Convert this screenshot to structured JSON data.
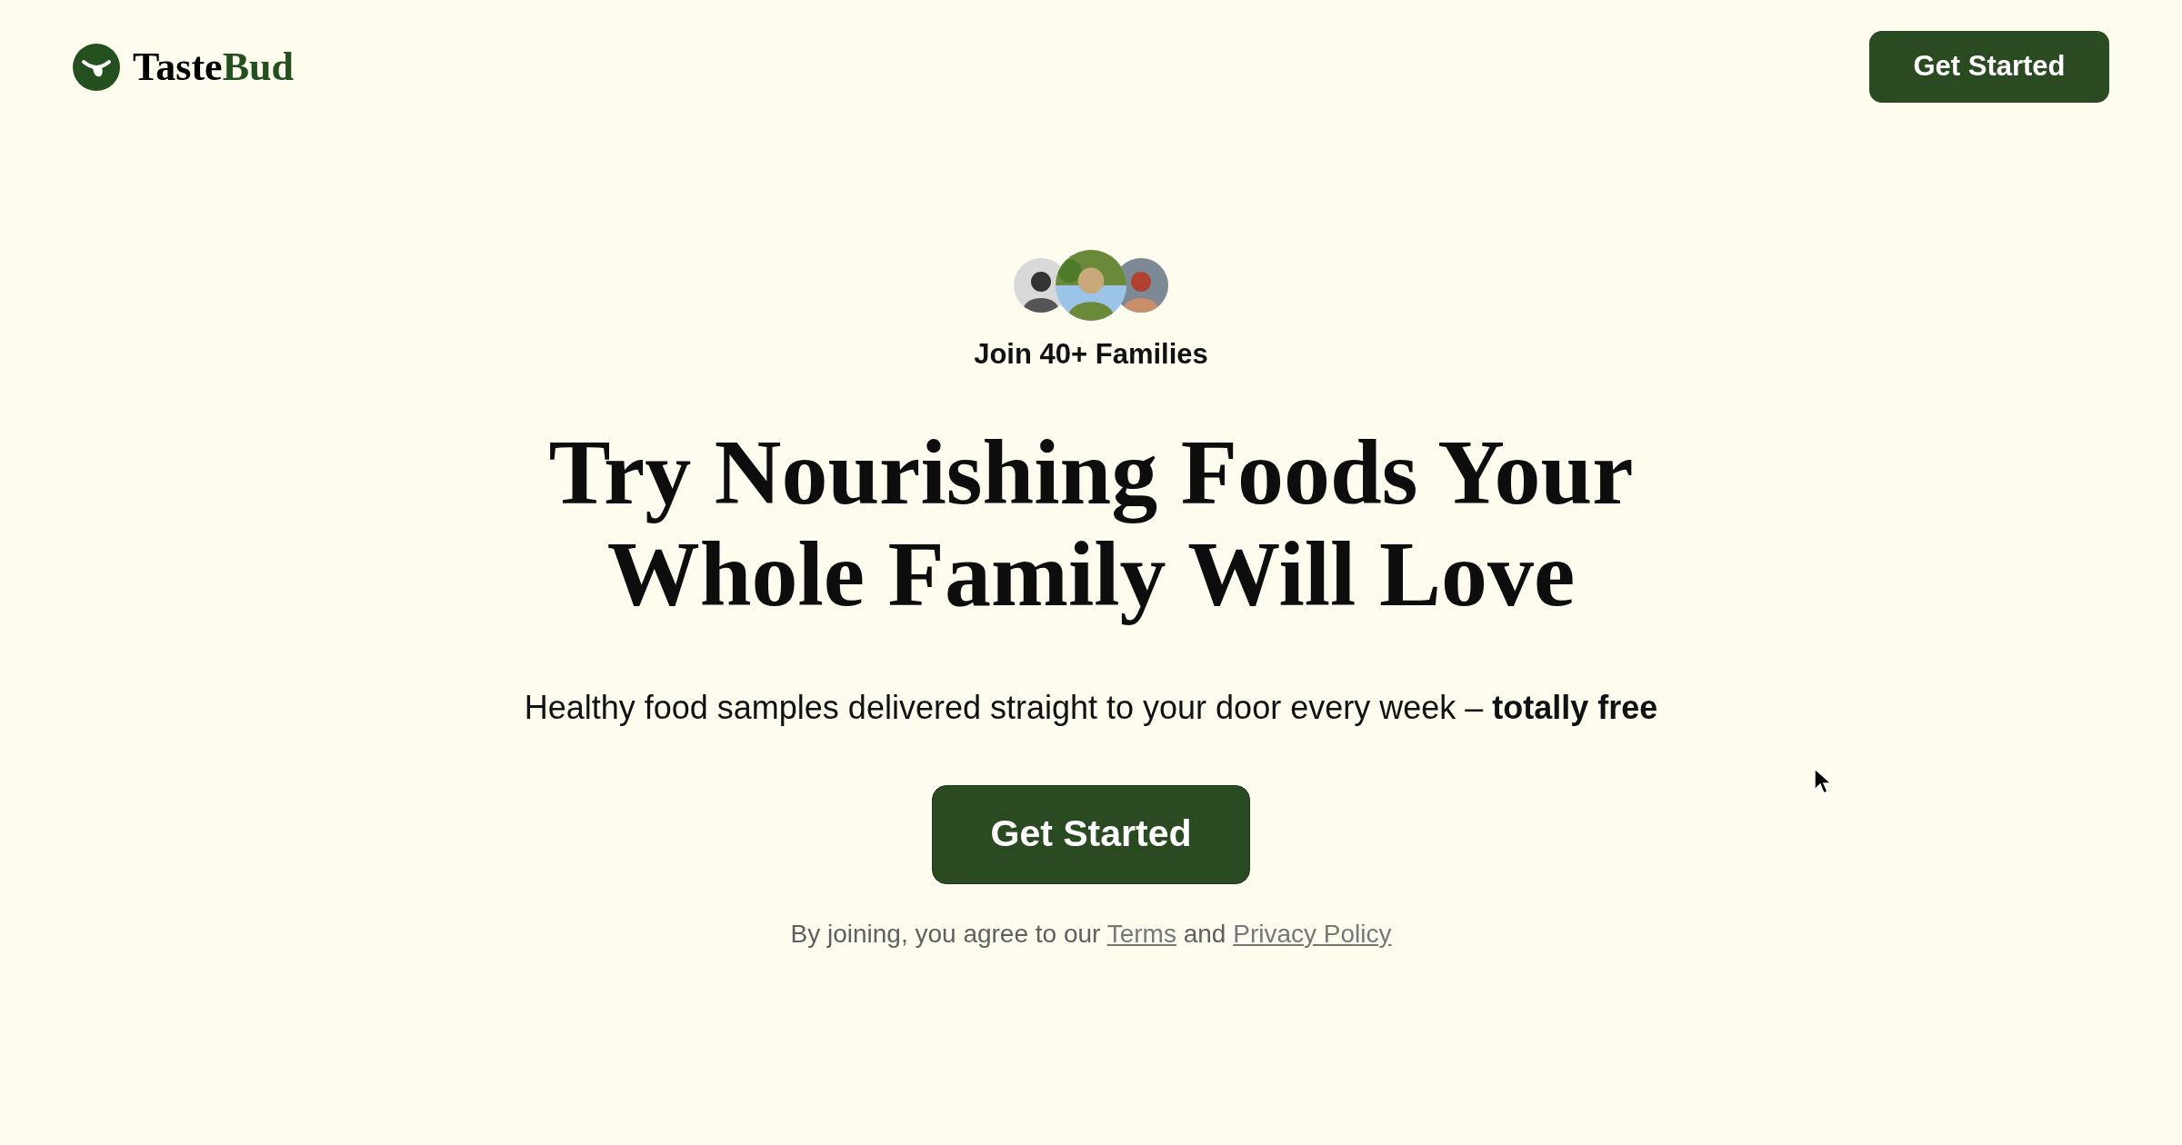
{
  "header": {
    "logo": {
      "name_start": "Taste",
      "name_end": "Bud"
    },
    "button": "Get Started"
  },
  "hero": {
    "social_proof": "Join 40+ Families",
    "headline": "Try Nourishing Foods Your Whole Family Will Love",
    "subtitle": "Healthy food samples delivered straight to your door every week – **totally free**",
    "button": "Get Started",
    "legal": {
      "prefix": "By joining, you agree to our",
      "terms_link": "Terms",
      "conjunction": "and",
      "privacy_link": "Privacy Policy"
    }
  }
}
